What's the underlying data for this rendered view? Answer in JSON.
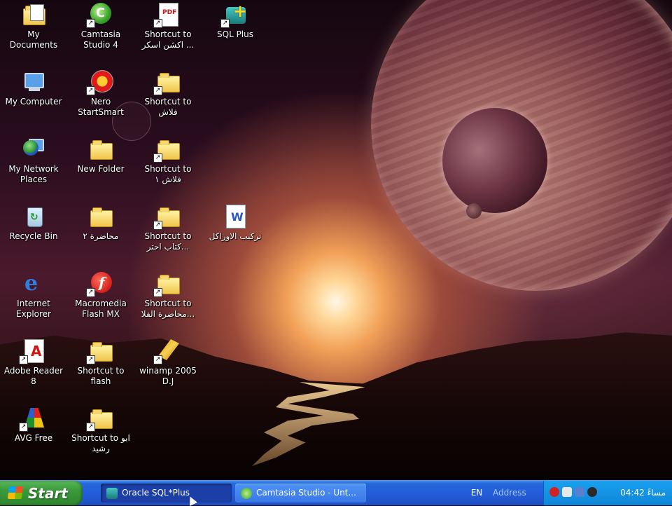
{
  "desktop": {
    "icons": [
      {
        "label": "My Documents"
      },
      {
        "label": "My Computer"
      },
      {
        "label": "My Network Places"
      },
      {
        "label": "Recycle Bin"
      },
      {
        "label": "Internet Explorer"
      },
      {
        "label": "Adobe Reader 8"
      },
      {
        "label": "AVG Free"
      },
      {
        "label": "Camtasia Studio 4"
      },
      {
        "label": "Nero StartSmart"
      },
      {
        "label": "New Folder"
      },
      {
        "label": "محاضرة ٢"
      },
      {
        "label": "Macromedia Flash MX"
      },
      {
        "label": "Shortcut to flash"
      },
      {
        "label": "Shortcut to ابو رشيد"
      },
      {
        "label": "Shortcut to اكشن اسكر ..."
      },
      {
        "label": "Shortcut to فلاش"
      },
      {
        "label": "Shortcut to فلاش ١"
      },
      {
        "label": "Shortcut to كتاب احتر..."
      },
      {
        "label": "Shortcut to محاضرة الفلا..."
      },
      {
        "label": "winamp 2005 D.J"
      },
      {
        "label": "SQL Plus"
      },
      {
        "label": "تركيب الاوراكل"
      }
    ]
  },
  "taskbar": {
    "start_label": "Start",
    "tasks": [
      {
        "label": "Oracle SQL*Plus",
        "active": true
      },
      {
        "label": "Camtasia Studio - Unt...",
        "active": false
      }
    ],
    "language": "EN",
    "address_label": "Address",
    "clock": "04:42 مساءً"
  }
}
